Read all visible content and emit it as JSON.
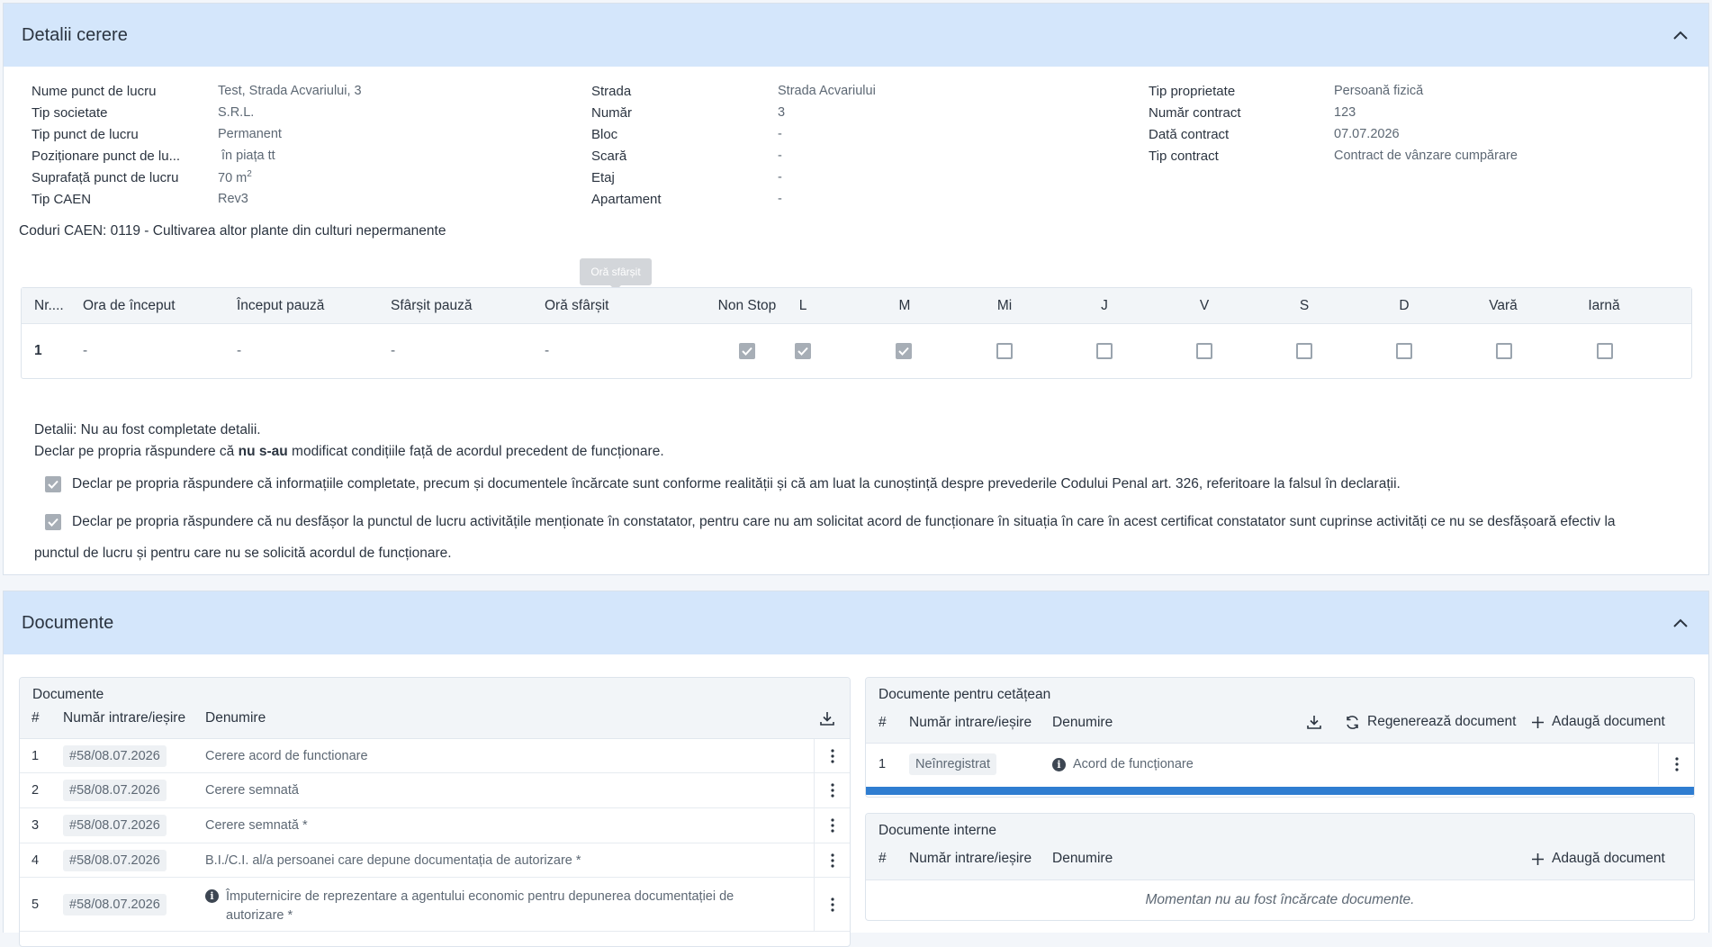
{
  "request_section": {
    "title": "Detalii cerere",
    "col1": [
      {
        "label": "Nume punct de lucru",
        "value": "Test, Strada Acvariului, 3"
      },
      {
        "label": "Tip societate",
        "value": "S.R.L."
      },
      {
        "label": "Tip punct de lucru",
        "value": "Permanent"
      },
      {
        "label": "Poziționare punct de lu...",
        "value": " în piața tt"
      },
      {
        "label": "Suprafață punct de lucru",
        "value": "70 m",
        "unit_sup": "2"
      },
      {
        "label": "Tip CAEN",
        "value": "Rev3"
      }
    ],
    "col2": [
      {
        "label": "Strada",
        "value": "Strada Acvariului"
      },
      {
        "label": "Număr",
        "value": "3"
      },
      {
        "label": "Bloc",
        "value": "-"
      },
      {
        "label": "Scară",
        "value": "-"
      },
      {
        "label": "Etaj",
        "value": "-"
      },
      {
        "label": "Apartament",
        "value": "-"
      }
    ],
    "col3": [
      {
        "label": "Tip proprietate",
        "value": "Persoană fizică"
      },
      {
        "label": "Număr contract",
        "value": "123"
      },
      {
        "label": "Dată contract",
        "value": "07.07.2026"
      },
      {
        "label": "Tip contract",
        "value": "Contract de vânzare cumpărare"
      }
    ],
    "caen_codes": "Coduri CAEN: 0119 - Cultivarea altor plante din culturi nepermanente",
    "tooltip": "Oră sfârșit",
    "schedule": {
      "headers": [
        "Nr....",
        "Ora de început",
        "Început pauză",
        "Sfârșit pauză",
        "Oră sfârșit",
        "Non Stop",
        "L",
        "M",
        "Mi",
        "J",
        "V",
        "S",
        "D",
        "Vară",
        "Iarnă"
      ],
      "row": {
        "nr": "1",
        "start": "-",
        "break_start": "-",
        "break_end": "-",
        "end": "-"
      },
      "checks": [
        true,
        true,
        true,
        false,
        false,
        false,
        false,
        false,
        false,
        false
      ]
    },
    "details": "Detalii: Nu au fost completate detalii.",
    "declaration_prefix": "Declar pe propria răspundere că ",
    "declaration_bold": "nu s-au",
    "declaration_suffix": " modificat condițiile față de acordul precedent de funcționare.",
    "declaration_1": "Declar pe propria răspundere că informațiile completate, precum și documentele încărcate sunt conforme realității și că am luat la cunoștință despre prevederile Codului Penal art. 326, referitoare la falsul în declarații.",
    "declaration_2a": "Declar pe propria răspundere că nu desfășor la punctul de lucru activitățile menționate în constatator, pentru care nu am solicitat acord de funcționare în situația în care în acest certificat constatator sunt cuprinse activități ce nu se desfășoară efectiv la",
    "declaration_2b": "punctul de lucru și pentru care nu se solicită acordul de funcționare.",
    "declaration_checks": [
      true,
      true
    ]
  },
  "documents_section": {
    "title": "Documente",
    "left_card": {
      "title": "Documente",
      "col_hash": "#",
      "col_number": "Număr intrare/ieșire",
      "col_name": "Denumire",
      "rows": [
        {
          "idx": "1",
          "number": "#58/08.07.2026",
          "name": "Cerere acord de functionare",
          "info": false
        },
        {
          "idx": "2",
          "number": "#58/08.07.2026",
          "name": "Cerere semnată",
          "info": false
        },
        {
          "idx": "3",
          "number": "#58/08.07.2026",
          "name": "Cerere semnată *",
          "info": false
        },
        {
          "idx": "4",
          "number": "#58/08.07.2026",
          "name": "B.I./C.I. al/a persoanei care depune documentația de autorizare *",
          "info": false
        },
        {
          "idx": "5",
          "number": "#58/08.07.2026",
          "name_line1": "Împuternicire de reprezentare a agentului economic pentru depunerea documentației de",
          "name_line2": "autorizare *",
          "info": true
        }
      ]
    },
    "citizen_card": {
      "title": "Documente pentru cetățean",
      "col_hash": "#",
      "col_number": "Număr intrare/ieșire",
      "col_name": "Denumire",
      "regenerate_label": "Regenerează document",
      "add_label": "Adaugă document",
      "rows": [
        {
          "idx": "1",
          "number": "Neînregistrat",
          "name": "Acord de funcționare"
        }
      ]
    },
    "internal_card": {
      "title": "Documente interne",
      "col_hash": "#",
      "col_number": "Număr intrare/ieșire",
      "col_name": "Denumire",
      "add_label": "Adaugă document",
      "empty_message": "Momentan nu au fost încărcate documente."
    }
  },
  "colors": {
    "header_bg": "#d4e6fb",
    "accent_bar": "#2f7dd1",
    "text": "#2b3440",
    "muted": "#5d6874"
  }
}
